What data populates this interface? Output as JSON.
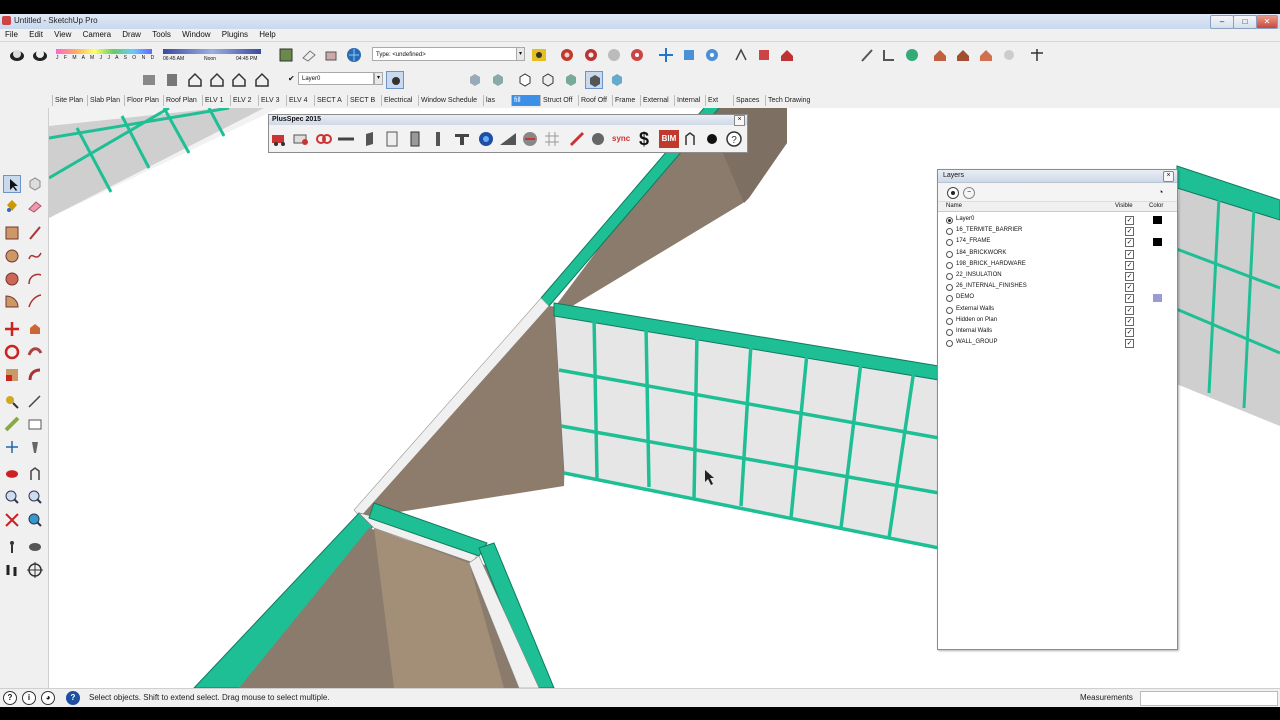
{
  "window": {
    "title": "Untitled - SketchUp Pro",
    "controls": [
      "–",
      "□",
      "✕"
    ]
  },
  "menu": [
    "File",
    "Edit",
    "View",
    "Camera",
    "Draw",
    "Tools",
    "Window",
    "Plugins",
    "Help"
  ],
  "shadow_settings": {
    "months": "J F M A M J J A S O N D",
    "time_start": "06:45 AM",
    "noon": "Noon",
    "time_end": "04:45 PM"
  },
  "type_selector": {
    "value": "Type: <undefined>"
  },
  "layer_selector": {
    "value": "Layer0"
  },
  "scene_tabs": [
    "Site Plan",
    "Slab Plan",
    "Floor Plan",
    "Roof Plan",
    "ELV 1",
    "ELV 2",
    "ELV 3",
    "ELV 4",
    "SECT A",
    "SECT B",
    "Electrical",
    "Window Schedule",
    "las",
    "fill",
    "Struct Off",
    "Roof Off",
    "Frame",
    "External",
    "Internal",
    "Ext",
    "Spaces",
    "Tech Drawing"
  ],
  "active_scene_index": 13,
  "plusspec": {
    "title": "PlusSpec 2015",
    "sync_label": "sync",
    "dollar_label": "$",
    "bim_label": "BIM"
  },
  "layers_panel": {
    "title": "Layers",
    "col_name": "Name",
    "col_visible": "Visible",
    "col_color": "Color",
    "rows": [
      {
        "name": "Layer0",
        "active": true,
        "visible": true,
        "color": "#000000"
      },
      {
        "name": "16_TERMITE_BARRIER",
        "active": false,
        "visible": true,
        "color": ""
      },
      {
        "name": "174_FRAME",
        "active": false,
        "visible": true,
        "color": "#000000"
      },
      {
        "name": "184_BRICKWORK",
        "active": false,
        "visible": true,
        "color": ""
      },
      {
        "name": "198_BRICK_HARDWARE",
        "active": false,
        "visible": true,
        "color": ""
      },
      {
        "name": "22_INSULATION",
        "active": false,
        "visible": true,
        "color": ""
      },
      {
        "name": "26_INTERNAL_FINISHES",
        "active": false,
        "visible": true,
        "color": ""
      },
      {
        "name": "DEMO",
        "active": false,
        "visible": true,
        "color": "#9a9ad6"
      },
      {
        "name": "External Walls",
        "active": false,
        "visible": true,
        "color": ""
      },
      {
        "name": "Hidden on Plan",
        "active": false,
        "visible": true,
        "color": ""
      },
      {
        "name": "Internal Walls",
        "active": false,
        "visible": true,
        "color": ""
      },
      {
        "name": "WALL_GROUP",
        "active": false,
        "visible": true,
        "color": ""
      }
    ]
  },
  "status": {
    "message": "Select objects. Shift to extend select. Drag mouse to select multiple.",
    "measurements_label": "Measurements",
    "measurements_value": ""
  },
  "colors": {
    "frame_teal": "#1fbf95",
    "wall_brown": "#8a7b6c",
    "glass": "#e8e8e8",
    "accent_blue": "#3c8fe6"
  }
}
